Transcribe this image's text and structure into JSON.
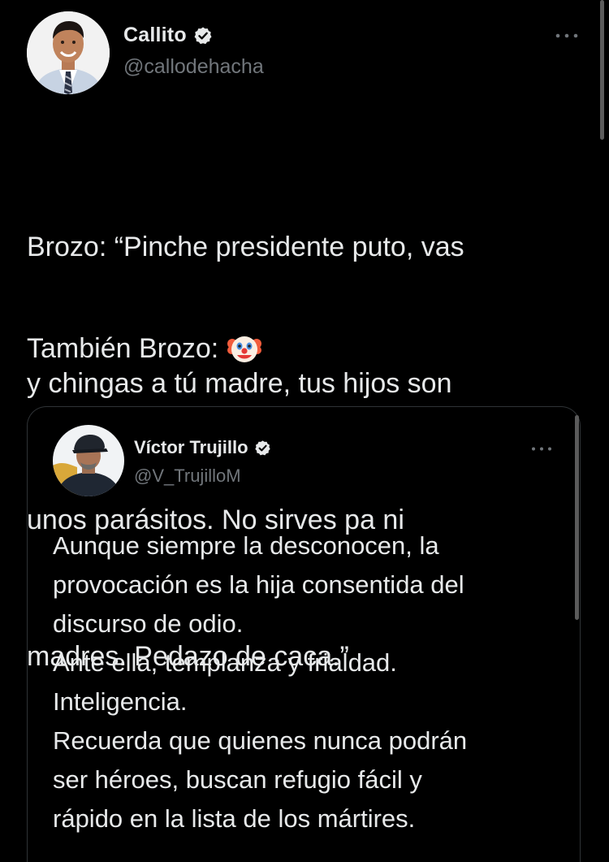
{
  "tweet": {
    "author": {
      "display_name": "Callito",
      "handle": "@callodehacha",
      "verified": true,
      "avatar_icon": "profile-photo-man-suit"
    },
    "more_icon": "more-horizontal-icon",
    "text_lines": [
      "Brozo: “Pinche presidente puto, vas",
      "y chingas a tú madre, tus hijos son",
      "unos parásitos. No sirves pa ni",
      "madres. Pedazo de caca.”"
    ],
    "also_text": "También Brozo:",
    "also_emoji": "clown-face-emoji"
  },
  "quoted_tweet": {
    "author": {
      "display_name": "Víctor Trujillo",
      "handle": "@V_TrujilloM",
      "verified": true,
      "avatar_icon": "profile-photo-man-cap"
    },
    "more_icon": "more-horizontal-icon",
    "text_lines": [
      "Aunque siempre la desconocen, la",
      "provocación es la hija consentida del",
      "discurso de odio.",
      "Ante ella, templanza y frialdad.",
      "Inteligencia.",
      "Recuerda que quienes nunca podrán",
      "ser héroes, buscan refugio fácil y",
      "rápido en la lista de los mártires."
    ]
  },
  "colors": {
    "background": "#000000",
    "text_primary": "#e7e9ea",
    "text_secondary": "#71767b",
    "border": "#2f3336",
    "verified_badge": "#e7e9ea"
  }
}
